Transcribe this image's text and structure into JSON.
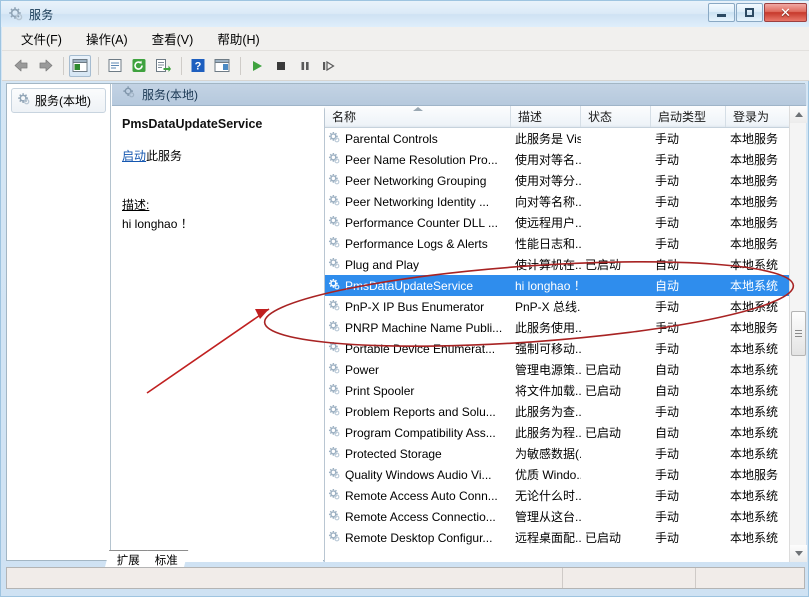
{
  "window": {
    "title": "服务",
    "title_icon": "gear-icon",
    "minimize_label": "最小化",
    "maximize_label": "最大化",
    "close_label": "关闭"
  },
  "menubar": {
    "items": [
      {
        "label": "文件(F)",
        "name": "menu-file"
      },
      {
        "label": "操作(A)",
        "name": "menu-action"
      },
      {
        "label": "查看(V)",
        "name": "menu-view"
      },
      {
        "label": "帮助(H)",
        "name": "menu-help"
      }
    ]
  },
  "toolbar": {
    "buttons": [
      {
        "name": "back-icon",
        "label": "后退"
      },
      {
        "name": "forward-icon",
        "label": "前进"
      },
      {
        "name": "show-hide-tree-icon",
        "label": "显示/隐藏控制台树"
      },
      {
        "name": "properties-icon",
        "label": "属性"
      },
      {
        "name": "refresh-icon",
        "label": "刷新"
      },
      {
        "name": "export-list-icon",
        "label": "导出列表"
      },
      {
        "name": "help-icon",
        "label": "帮助"
      },
      {
        "name": "show-hide-action-pane-icon",
        "label": "显示/隐藏操作窗格"
      },
      {
        "name": "start-service-icon",
        "label": "启动服务"
      },
      {
        "name": "stop-service-icon",
        "label": "停止服务"
      },
      {
        "name": "pause-service-icon",
        "label": "暂停服务"
      },
      {
        "name": "restart-service-icon",
        "label": "重启服务"
      }
    ]
  },
  "tree": {
    "node_label": "服务(本地)",
    "node_icon": "gear-icon"
  },
  "pane": {
    "header": "服务(本地)",
    "header_icon": "gear-icon"
  },
  "details": {
    "service_name": "PmsDataUpdateService",
    "action_link": "启动",
    "action_suffix": "此服务",
    "description_label": "描述:",
    "description_text": "hi longhao ！"
  },
  "list": {
    "columns": [
      {
        "key": "name",
        "label": "名称",
        "sorted": true
      },
      {
        "key": "description",
        "label": "描述",
        "sorted": false
      },
      {
        "key": "status",
        "label": "状态",
        "sorted": false
      },
      {
        "key": "startup_type",
        "label": "启动类型",
        "sorted": false
      },
      {
        "key": "log_on_as",
        "label": "登录为",
        "sorted": false
      }
    ],
    "rows": [
      {
        "name": "Parental Controls",
        "description": "此服务是 Vis...",
        "status": "",
        "startup_type": "手动",
        "log_on_as": "本地服务",
        "selected": false
      },
      {
        "name": "Peer Name Resolution Pro...",
        "description": "使用对等名...",
        "status": "",
        "startup_type": "手动",
        "log_on_as": "本地服务",
        "selected": false
      },
      {
        "name": "Peer Networking Grouping",
        "description": "使用对等分...",
        "status": "",
        "startup_type": "手动",
        "log_on_as": "本地服务",
        "selected": false
      },
      {
        "name": "Peer Networking Identity ...",
        "description": "向对等名称...",
        "status": "",
        "startup_type": "手动",
        "log_on_as": "本地服务",
        "selected": false
      },
      {
        "name": "Performance Counter DLL ...",
        "description": "使远程用户...",
        "status": "",
        "startup_type": "手动",
        "log_on_as": "本地服务",
        "selected": false
      },
      {
        "name": "Performance Logs & Alerts",
        "description": "性能日志和...",
        "status": "",
        "startup_type": "手动",
        "log_on_as": "本地服务",
        "selected": false
      },
      {
        "name": "Plug and Play",
        "description": "使计算机在...",
        "status": "已启动",
        "startup_type": "自动",
        "log_on_as": "本地系统",
        "selected": false
      },
      {
        "name": "PmsDataUpdateService",
        "description": "hi longhao ！",
        "status": "",
        "startup_type": "自动",
        "log_on_as": "本地系统",
        "selected": true
      },
      {
        "name": "PnP-X IP Bus Enumerator",
        "description": "PnP-X 总线...",
        "status": "",
        "startup_type": "手动",
        "log_on_as": "本地系统",
        "selected": false
      },
      {
        "name": "PNRP Machine Name Publi...",
        "description": "此服务使用...",
        "status": "",
        "startup_type": "手动",
        "log_on_as": "本地服务",
        "selected": false
      },
      {
        "name": "Portable Device Enumerat...",
        "description": "强制可移动...",
        "status": "",
        "startup_type": "手动",
        "log_on_as": "本地系统",
        "selected": false
      },
      {
        "name": "Power",
        "description": "管理电源策...",
        "status": "已启动",
        "startup_type": "自动",
        "log_on_as": "本地系统",
        "selected": false
      },
      {
        "name": "Print Spooler",
        "description": "将文件加载...",
        "status": "已启动",
        "startup_type": "自动",
        "log_on_as": "本地系统",
        "selected": false
      },
      {
        "name": "Problem Reports and Solu...",
        "description": "此服务为查...",
        "status": "",
        "startup_type": "手动",
        "log_on_as": "本地系统",
        "selected": false
      },
      {
        "name": "Program Compatibility Ass...",
        "description": "此服务为程...",
        "status": "已启动",
        "startup_type": "自动",
        "log_on_as": "本地系统",
        "selected": false
      },
      {
        "name": "Protected Storage",
        "description": "为敏感数据(...",
        "status": "",
        "startup_type": "手动",
        "log_on_as": "本地系统",
        "selected": false
      },
      {
        "name": "Quality Windows Audio Vi...",
        "description": "优质 Windo...",
        "status": "",
        "startup_type": "手动",
        "log_on_as": "本地服务",
        "selected": false
      },
      {
        "name": "Remote Access Auto Conn...",
        "description": "无论什么时...",
        "status": "",
        "startup_type": "手动",
        "log_on_as": "本地系统",
        "selected": false
      },
      {
        "name": "Remote Access Connectio...",
        "description": "管理从这台...",
        "status": "",
        "startup_type": "手动",
        "log_on_as": "本地系统",
        "selected": false
      },
      {
        "name": "Remote Desktop Configur...",
        "description": "远程桌面配...",
        "status": "已启动",
        "startup_type": "手动",
        "log_on_as": "本地系统",
        "selected": false
      }
    ]
  },
  "tabs": [
    {
      "label": "扩展",
      "active": false
    },
    {
      "label": "标准",
      "active": true
    }
  ],
  "annotation": {
    "color": "#b22020",
    "shapes": [
      "ellipse-highlight",
      "pointer-arrow"
    ]
  },
  "colors": {
    "selection_blue": "#2f8ded",
    "title_bar": "#d6e7f5",
    "pane_header": "#bcd0e2",
    "link": "#1557b0",
    "annotation_red": "#b22020"
  }
}
